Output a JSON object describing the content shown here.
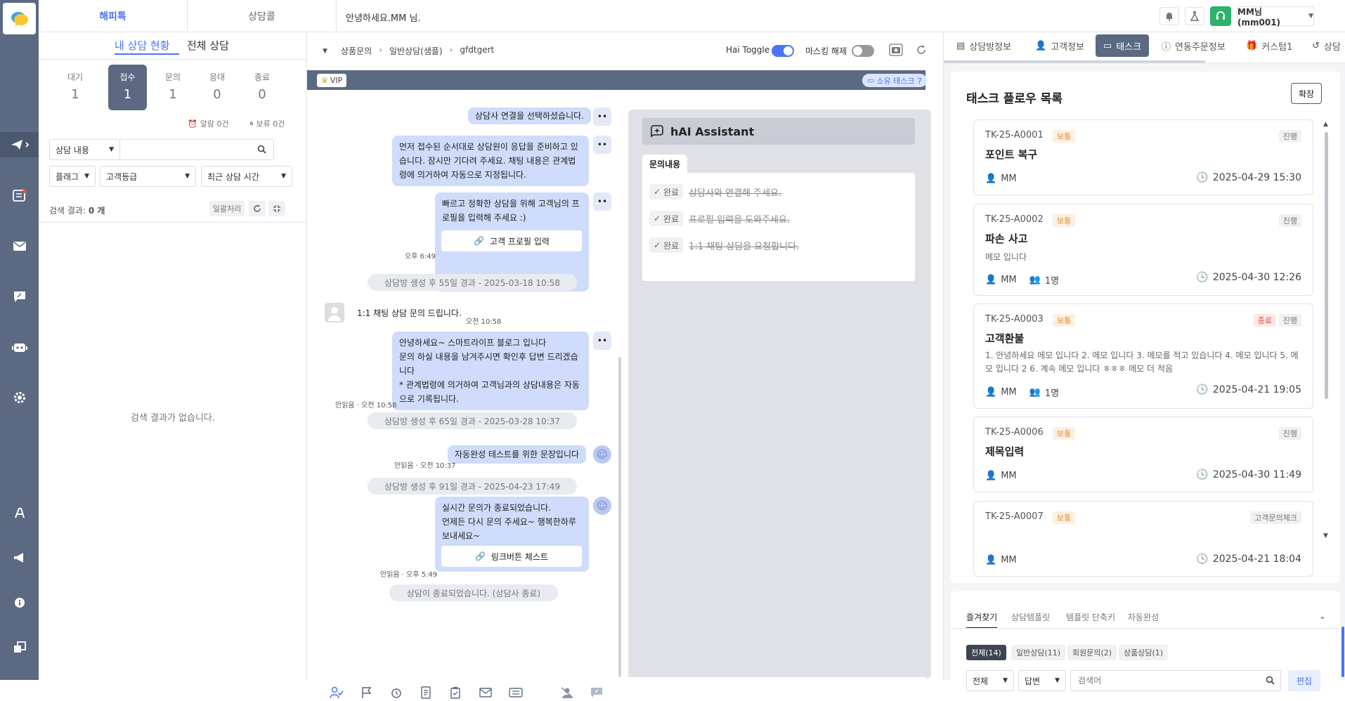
{
  "colors": {
    "rail": "#5b6a82",
    "accent": "#4a74f5",
    "bubble": "#cfdcfb",
    "priority": "#e6892e",
    "danger": "#e04848",
    "green": "#2db36b"
  },
  "topbar": {
    "tab_happytalk": "해피톡",
    "tab_call": "상담콜",
    "greeting": "안녕하세요.MM 님.",
    "user": "MM님(mm001)"
  },
  "left": {
    "tab_mine": "내 상담 현황",
    "tab_all": "전체 상담",
    "stats": [
      {
        "label": "대기",
        "value": "1"
      },
      {
        "label": "접수",
        "value": "1"
      },
      {
        "label": "문의",
        "value": "1"
      },
      {
        "label": "응대",
        "value": "0"
      },
      {
        "label": "종료",
        "value": "0"
      }
    ],
    "alarm": "알람 0건",
    "hold": "보류 0건",
    "search_type": "상담 내용",
    "search_placeholder": "",
    "flag": "플래그",
    "grade": "고객등급",
    "sort": "최근 상담 시간",
    "result_label": "검색 결과:",
    "result_count": "0 개",
    "batch": "일괄처리",
    "empty": "검색 결과가 없습니다."
  },
  "breadcrumb": {
    "c1": "상품문의",
    "c2": "일반상담(샘플)",
    "c3": "gfdtgert"
  },
  "toggles": {
    "hai": "Hai Toggle",
    "mask": "마스킹 해제"
  },
  "chat": {
    "vip": "VIP",
    "own_task": "소유 태스크 7",
    "m1": "상담사 연결을 선택하셨습니다.",
    "m2": "먼저 접수된 순서대로 상담원이 응답을 준비하고 있습니다. 잠시만 기다려 주세요. 채팅 내용은 관계법령에 의거하여 자동으로 지정됩니다.",
    "m3": "빠르고 정확한 상담을 위해 고객님의 프로필을 입력해 주세요 :)",
    "m3_btn": "고객 프로필 입력",
    "m3_time": "오후 6:49",
    "sys1": "상담방 생성 후 55일 경과 - 2025-03-18 10:58",
    "cust1": "1:1 채팅 상담 문의 드립니다.",
    "cust1_time": "오전 10:58",
    "m4": "안녕하세요~ 스마트라이프 블로그 입니다\n문의 하실 내용을 남겨주시면 확인후 답변 드리겠습니다\n* 관계법령에 의거하여 고객님과의 상담내용은 자동으로 기록됩니다.",
    "m4_time": "안읽음 · 오전 10:58",
    "sys2": "상담방 생성 후 65일 경과 - 2025-03-28 10:37",
    "m5": "자동완성 테스트를 위한 문장입니다",
    "m5_time": "안읽음 · 오전 10:37",
    "sys3": "상담방 생성 후 91일 경과 - 2025-04-23 17:49",
    "m6": "실시간 문의가 종료되었습니다.\n언제든 다시 문의 주세요~ 행복한하루 보내세요~",
    "m6_btn": "링크버튼 체스트",
    "m6_time": "안읽음 · 오후 5:49",
    "sys4": "상담이 종료되었습니다. (상담사 종료)"
  },
  "hai": {
    "title": "hAI Assistant",
    "tab": "문의내용",
    "done": "완료",
    "items": [
      "상담사와 연결해 주세요.",
      "프로필 입력을 도와주세요.",
      "1:1 채팅 상담을 요청합니다."
    ]
  },
  "right": {
    "tabs": [
      "상담방정보",
      "고객정보",
      "태스크",
      "연동주문정보",
      "커스텀1",
      "상담"
    ],
    "title": "태스크 플로우 목록",
    "expand": "확장",
    "cards": [
      {
        "id": "TK-25-A0001",
        "pri": "보통",
        "status": "진행",
        "title": "포인트 복구",
        "desc": "",
        "owner": "MM",
        "people": "",
        "date": "2025-04-29 15:30"
      },
      {
        "id": "TK-25-A0002",
        "pri": "보통",
        "status": "진행",
        "title": "파손 사고",
        "desc": "메모 입니다",
        "owner": "MM",
        "people": "1명",
        "date": "2025-04-30 12:26"
      },
      {
        "id": "TK-25-A0003",
        "pri": "보통",
        "status2": "종료",
        "status": "진행",
        "title": "고객환불",
        "desc": "1. 안녕하세요 메모 입니다 2. 메모 입니다 3. 메모를 적고 있습니다 4. 메모 입니다 5. 메모 입니다 2 6. 계속 메모 입니다 ㅎㅎㅎ 메모 더 적음",
        "owner": "MM",
        "people": "1명",
        "date": "2025-04-21 19:05"
      },
      {
        "id": "TK-25-A0006",
        "pri": "보통",
        "status": "진행",
        "title": "제목입력",
        "desc": "",
        "owner": "MM",
        "people": "",
        "date": "2025-04-30 11:49"
      },
      {
        "id": "TK-25-A0007",
        "pri": "보통",
        "status": "고객문의체크",
        "title": "",
        "desc": "",
        "owner": "MM",
        "people": "",
        "date": "2025-04-21 18:04"
      }
    ],
    "bottom_tabs": [
      "즐겨찾기",
      "상담템플릿",
      "템플릿 단축키",
      "자동완성"
    ],
    "chips": [
      "전체(14)",
      "일반상담(11)",
      "회원문의(2)",
      "상품상담(1)"
    ],
    "sel1": "전체",
    "sel2": "답변",
    "search_placeholder": "검색어",
    "edit": "편집"
  }
}
